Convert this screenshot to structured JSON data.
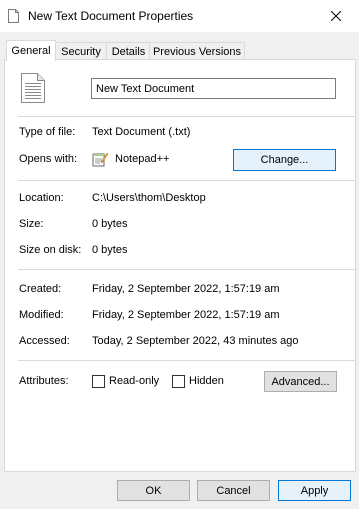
{
  "window": {
    "title": "New Text Document Properties"
  },
  "tabs": [
    "General",
    "Security",
    "Details",
    "Previous Versions"
  ],
  "general": {
    "file_name": "New Text Document",
    "type_label": "Type of file:",
    "type_value": "Text Document (.txt)",
    "opens_label": "Opens with:",
    "opens_value": "Notepad++",
    "change_button": "Change...",
    "location_label": "Location:",
    "location_value": "C:\\Users\\thom\\Desktop",
    "size_label": "Size:",
    "size_value": "0 bytes",
    "size_disk_label": "Size on disk:",
    "size_disk_value": "0 bytes",
    "created_label": "Created:",
    "created_value": "Friday, 2 September 2022, 1:57:19 am",
    "modified_label": "Modified:",
    "modified_value": "Friday, 2 September 2022, 1:57:19 am",
    "accessed_label": "Accessed:",
    "accessed_value": "Today, 2 September 2022, 43 minutes ago",
    "attributes_label": "Attributes:",
    "readonly_label": "Read-only",
    "hidden_label": "Hidden",
    "advanced_button": "Advanced..."
  },
  "footer": {
    "ok": "OK",
    "cancel": "Cancel",
    "apply": "Apply"
  },
  "icons": {
    "title": "document-icon",
    "close": "close-icon",
    "file": "text-file-icon",
    "notepad": "notepad-plus-plus-icon"
  }
}
